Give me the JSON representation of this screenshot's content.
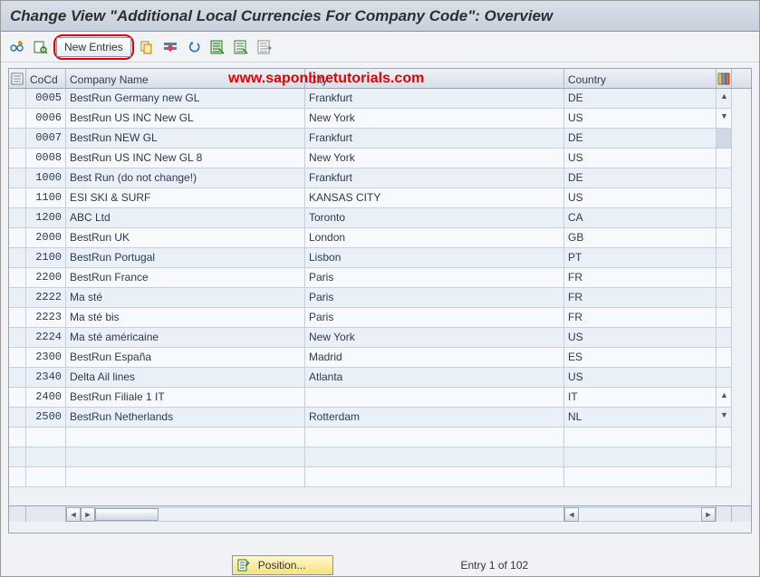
{
  "header": {
    "title": "Change View \"Additional Local Currencies For Company Code\": Overview"
  },
  "toolbar": {
    "new_entries_label": "New Entries"
  },
  "watermark": "www.saponlinetutorials.com",
  "columns": {
    "cocd": "CoCd",
    "company_name": "Company Name",
    "city": "City",
    "country": "Country"
  },
  "rows": [
    {
      "cocd": "0005",
      "name": "BestRun Germany new GL",
      "city": "Frankfurt",
      "country": "DE"
    },
    {
      "cocd": "0006",
      "name": "BestRun US INC New GL",
      "city": "New York",
      "country": "US"
    },
    {
      "cocd": "0007",
      "name": "BestRun NEW GL",
      "city": "Frankfurt",
      "country": "DE"
    },
    {
      "cocd": "0008",
      "name": "BestRun US INC New GL 8",
      "city": "New York",
      "country": "US"
    },
    {
      "cocd": "1000",
      "name": "Best Run (do not change!)",
      "city": "Frankfurt",
      "country": "DE"
    },
    {
      "cocd": "1100",
      "name": "ESI SKI & SURF",
      "city": "KANSAS CITY",
      "country": "US"
    },
    {
      "cocd": "1200",
      "name": "ABC Ltd",
      "city": "Toronto",
      "country": "CA"
    },
    {
      "cocd": "2000",
      "name": "BestRun UK",
      "city": "London",
      "country": "GB"
    },
    {
      "cocd": "2100",
      "name": "BestRun Portugal",
      "city": "Lisbon",
      "country": "PT"
    },
    {
      "cocd": "2200",
      "name": "BestRun France",
      "city": "Paris",
      "country": "FR"
    },
    {
      "cocd": "2222",
      "name": "Ma sté",
      "city": "Paris",
      "country": "FR"
    },
    {
      "cocd": "2223",
      "name": "Ma sté bis",
      "city": "Paris",
      "country": "FR"
    },
    {
      "cocd": "2224",
      "name": "Ma sté américaine",
      "city": "New York",
      "country": "US"
    },
    {
      "cocd": "2300",
      "name": "BestRun España",
      "city": "Madrid",
      "country": "ES"
    },
    {
      "cocd": "2340",
      "name": "Delta Ail lines",
      "city": "Atlanta",
      "country": "US"
    },
    {
      "cocd": "2400",
      "name": "BestRun Filiale 1 IT",
      "city": "",
      "country": "IT"
    },
    {
      "cocd": "2500",
      "name": "BestRun Netherlands",
      "city": "Rotterdam",
      "country": "NL"
    }
  ],
  "footer": {
    "position_label": "Position...",
    "entry_info": "Entry 1 of 102"
  }
}
